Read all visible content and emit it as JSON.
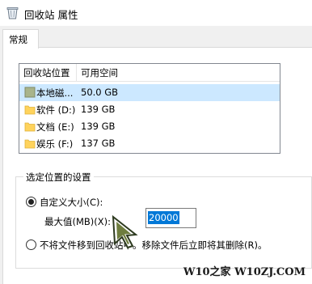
{
  "window": {
    "title": "回收站 属性",
    "icon": "recycle-bin-icon"
  },
  "tabs": [
    {
      "label": "常规"
    }
  ],
  "list": {
    "headers": {
      "location": "回收站位置",
      "space": "可用空间"
    },
    "rows": [
      {
        "name": "本地磁...",
        "space": "50.0 GB",
        "selected": true,
        "icon": "drive-folder-icon"
      },
      {
        "name": "软件 (D:)",
        "space": "139 GB",
        "selected": false,
        "icon": "folder-icon"
      },
      {
        "name": "文档 (E:)",
        "space": "139 GB",
        "selected": false,
        "icon": "folder-icon"
      },
      {
        "name": "娱乐 (F:)",
        "space": "137 GB",
        "selected": false,
        "icon": "folder-icon"
      }
    ]
  },
  "settings": {
    "group_title": "选定位置的设置",
    "custom_size_label": "自定义大小(C):",
    "custom_size_checked": true,
    "max_label": "最大值(MB)(X):",
    "max_value": "20000",
    "no_recycle_label": "不将文件移到回收站中。移除文件后立即将其删除(R)。",
    "no_recycle_checked": false
  },
  "watermark": "W10之家 W10ZJ.COM",
  "colors": {
    "selection": "#0078d7",
    "row_highlight": "#cce8ff",
    "folder": "#ffd35c"
  }
}
